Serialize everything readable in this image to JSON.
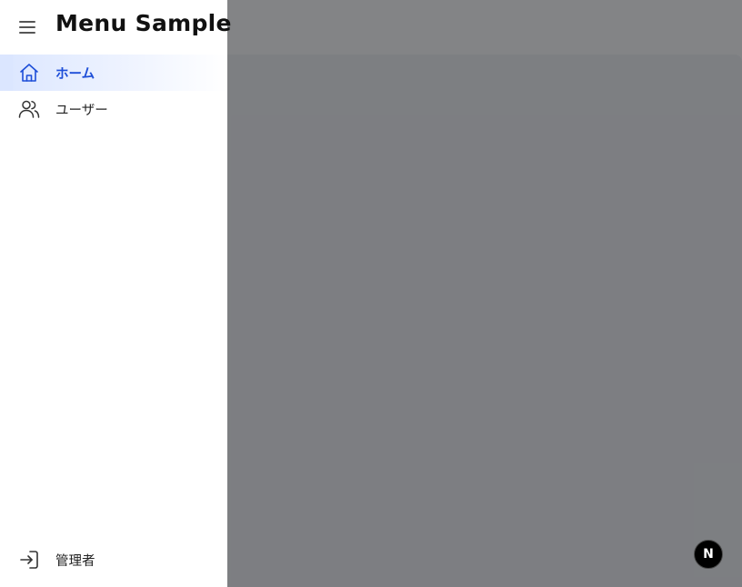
{
  "main": {
    "content_text": "。"
  },
  "drawer": {
    "title": "Menu Sample",
    "menu_icon": "hamburger-icon",
    "items": [
      {
        "label": "ホーム",
        "icon": "home-icon",
        "active": true
      },
      {
        "label": "ユーザー",
        "icon": "users-icon",
        "active": false
      }
    ],
    "footer": {
      "label": "管理者",
      "icon": "login-icon"
    }
  },
  "fab": {
    "label": "N"
  },
  "colors": {
    "accent": "#1d4ed8",
    "active_bg": "#dbe6ff",
    "overlay": "#08090e"
  }
}
